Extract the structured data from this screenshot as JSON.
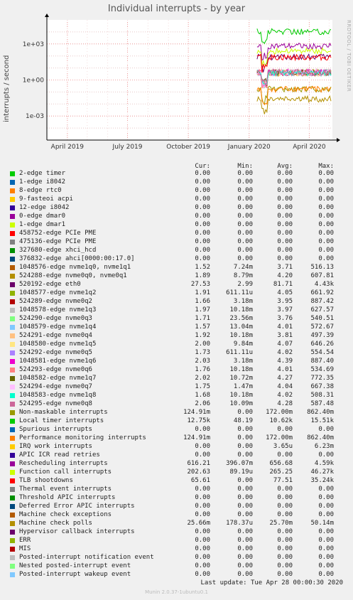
{
  "title": "Individual interrupts - by year",
  "side_label": "RRDTOOL / TOBI OETIKER",
  "footer": {
    "last_update": "Last update: Tue Apr 28 00:00:30 2020",
    "generator": "Munin 2.0.37-1ubuntu0.1"
  },
  "legend_headers": {
    "cur": "Cur:",
    "min": "Min:",
    "avg": "Avg:",
    "max": "Max:"
  },
  "chart_data": {
    "type": "line",
    "title": "Individual interrupts - by year",
    "ylabel": "interrupts / second",
    "yscale": "log",
    "yticks": [
      "1e+03",
      "1e+00",
      "1e-03"
    ],
    "ylim": [
      1e-05,
      100000.0
    ],
    "xticks": [
      "April 2019",
      "July 2019",
      "October 2019",
      "January 2020",
      "April 2020"
    ],
    "grid": true,
    "data_start": "January 2020",
    "series": [
      {
        "name": "2-edge timer",
        "color": "#00cc00",
        "cur": "0.00",
        "min": "0.00",
        "avg": "0.00",
        "max": "0.00"
      },
      {
        "name": "1-edge i8042",
        "color": "#0066b3",
        "cur": "0.00",
        "min": "0.00",
        "avg": "0.00",
        "max": "0.00"
      },
      {
        "name": "8-edge rtc0",
        "color": "#ff8000",
        "cur": "0.00",
        "min": "0.00",
        "avg": "0.00",
        "max": "0.00"
      },
      {
        "name": "9-fasteoi acpi",
        "color": "#ffcc00",
        "cur": "0.00",
        "min": "0.00",
        "avg": "0.00",
        "max": "0.00"
      },
      {
        "name": "12-edge i8042",
        "color": "#330099",
        "cur": "0.00",
        "min": "0.00",
        "avg": "0.00",
        "max": "0.00"
      },
      {
        "name": "0-edge dmar0",
        "color": "#990099",
        "cur": "0.00",
        "min": "0.00",
        "avg": "0.00",
        "max": "0.00"
      },
      {
        "name": "1-edge dmar1",
        "color": "#ccff00",
        "cur": "0.00",
        "min": "0.00",
        "avg": "0.00",
        "max": "0.00"
      },
      {
        "name": "458752-edge PCIe PME",
        "color": "#ff0000",
        "cur": "0.00",
        "min": "0.00",
        "avg": "0.00",
        "max": "0.00"
      },
      {
        "name": "475136-edge PCIe PME",
        "color": "#808080",
        "cur": "0.00",
        "min": "0.00",
        "avg": "0.00",
        "max": "0.00"
      },
      {
        "name": "327680-edge xhci_hcd",
        "color": "#008f00",
        "cur": "0.00",
        "min": "0.00",
        "avg": "0.00",
        "max": "0.00"
      },
      {
        "name": "376832-edge ahci[0000:00:17.0]",
        "color": "#00487d",
        "cur": "0.00",
        "min": "0.00",
        "avg": "0.00",
        "max": "0.00"
      },
      {
        "name": "1048576-edge nvme1q0, nvme1q1",
        "color": "#b35a00",
        "cur": "1.52",
        "min": "7.24m",
        "avg": "3.71",
        "max": "516.13"
      },
      {
        "name": "524288-edge nvme0q0, nvme0q1",
        "color": "#b38f00",
        "cur": "1.89",
        "min": "8.79m",
        "avg": "4.20",
        "max": "607.81"
      },
      {
        "name": "520192-edge eth0",
        "color": "#6b006b",
        "cur": "27.53",
        "min": "2.99",
        "avg": "81.71",
        "max": "4.43k"
      },
      {
        "name": "1048577-edge nvme1q2",
        "color": "#8fb300",
        "cur": "1.91",
        "min": "611.11u",
        "avg": "4.05",
        "max": "661.92"
      },
      {
        "name": "524289-edge nvme0q2",
        "color": "#b30000",
        "cur": "1.66",
        "min": "3.18m",
        "avg": "3.95",
        "max": "887.42"
      },
      {
        "name": "1048578-edge nvme1q3",
        "color": "#bebebe",
        "cur": "1.97",
        "min": "10.18m",
        "avg": "3.97",
        "max": "627.57"
      },
      {
        "name": "524290-edge nvme0q3",
        "color": "#80ff80",
        "cur": "1.71",
        "min": "23.56m",
        "avg": "3.76",
        "max": "540.51"
      },
      {
        "name": "1048579-edge nvme1q4",
        "color": "#80c9ff",
        "cur": "1.57",
        "min": "13.04m",
        "avg": "4.01",
        "max": "572.67"
      },
      {
        "name": "524291-edge nvme0q4",
        "color": "#ffc080",
        "cur": "1.92",
        "min": "10.18m",
        "avg": "3.81",
        "max": "497.39"
      },
      {
        "name": "1048580-edge nvme1q5",
        "color": "#ffe680",
        "cur": "2.00",
        "min": "9.84m",
        "avg": "4.07",
        "max": "646.26"
      },
      {
        "name": "524292-edge nvme0q5",
        "color": "#aa80ff",
        "cur": "1.73",
        "min": "611.11u",
        "avg": "4.02",
        "max": "554.54"
      },
      {
        "name": "1048581-edge nvme1q6",
        "color": "#ee00cc",
        "cur": "2.03",
        "min": "3.18m",
        "avg": "4.39",
        "max": "887.40"
      },
      {
        "name": "524293-edge nvme0q6",
        "color": "#ff8080",
        "cur": "1.76",
        "min": "10.18m",
        "avg": "4.01",
        "max": "534.69"
      },
      {
        "name": "1048582-edge nvme1q7",
        "color": "#666600",
        "cur": "2.02",
        "min": "10.72m",
        "avg": "4.27",
        "max": "772.35"
      },
      {
        "name": "524294-edge nvme0q7",
        "color": "#ffbfff",
        "cur": "1.75",
        "min": "1.47m",
        "avg": "4.04",
        "max": "667.38"
      },
      {
        "name": "1048583-edge nvme1q8",
        "color": "#00ffcc",
        "cur": "1.68",
        "min": "10.18m",
        "avg": "4.02",
        "max": "508.31"
      },
      {
        "name": "524295-edge nvme0q8",
        "color": "#cc6699",
        "cur": "2.06",
        "min": "10.09m",
        "avg": "4.28",
        "max": "587.48"
      },
      {
        "name": "Non-maskable interrupts",
        "color": "#999900",
        "cur": "124.91m",
        "min": "0.00",
        "avg": "172.00m",
        "max": "862.40m"
      },
      {
        "name": "Local timer interrupts",
        "color": "#00cc00",
        "cur": "12.75k",
        "min": "48.19",
        "avg": "10.62k",
        "max": "15.51k"
      },
      {
        "name": "Spurious interrupts",
        "color": "#0066b3",
        "cur": "0.00",
        "min": "0.00",
        "avg": "0.00",
        "max": "0.00"
      },
      {
        "name": "Performance monitoring interrupts",
        "color": "#ff8000",
        "cur": "124.91m",
        "min": "0.00",
        "avg": "172.00m",
        "max": "862.40m"
      },
      {
        "name": "IRQ work interrupts",
        "color": "#ffcc00",
        "cur": "0.00",
        "min": "0.00",
        "avg": "3.65u",
        "max": "6.23m"
      },
      {
        "name": "APIC ICR read retries",
        "color": "#330099",
        "cur": "0.00",
        "min": "0.00",
        "avg": "0.00",
        "max": "0.00"
      },
      {
        "name": "Rescheduling interrupts",
        "color": "#990099",
        "cur": "616.21",
        "min": "396.07m",
        "avg": "656.68",
        "max": "4.59k"
      },
      {
        "name": "Function call interrupts",
        "color": "#ccff00",
        "cur": "202.63",
        "min": "89.19u",
        "avg": "265.25",
        "max": "46.27k"
      },
      {
        "name": "TLB shootdowns",
        "color": "#ff0000",
        "cur": "65.61",
        "min": "0.00",
        "avg": "77.51",
        "max": "35.24k"
      },
      {
        "name": "Thermal event interrupts",
        "color": "#808080",
        "cur": "0.00",
        "min": "0.00",
        "avg": "0.00",
        "max": "0.00"
      },
      {
        "name": "Threshold APIC interrupts",
        "color": "#008f00",
        "cur": "0.00",
        "min": "0.00",
        "avg": "0.00",
        "max": "0.00"
      },
      {
        "name": "Deferred Error APIC interrupts",
        "color": "#00487d",
        "cur": "0.00",
        "min": "0.00",
        "avg": "0.00",
        "max": "0.00"
      },
      {
        "name": "Machine check exceptions",
        "color": "#b35a00",
        "cur": "0.00",
        "min": "0.00",
        "avg": "0.00",
        "max": "0.00"
      },
      {
        "name": "Machine check polls",
        "color": "#b38f00",
        "cur": "25.66m",
        "min": "178.37u",
        "avg": "25.70m",
        "max": "50.14m"
      },
      {
        "name": "Hypervisor callback interrupts",
        "color": "#6b006b",
        "cur": "0.00",
        "min": "0.00",
        "avg": "0.00",
        "max": "0.00"
      },
      {
        "name": "ERR",
        "color": "#8fb300",
        "cur": "0.00",
        "min": "0.00",
        "avg": "0.00",
        "max": "0.00"
      },
      {
        "name": "MIS",
        "color": "#b30000",
        "cur": "0.00",
        "min": "0.00",
        "avg": "0.00",
        "max": "0.00"
      },
      {
        "name": "Posted-interrupt notification event",
        "color": "#bebebe",
        "cur": "0.00",
        "min": "0.00",
        "avg": "0.00",
        "max": "0.00"
      },
      {
        "name": "Nested posted-interrupt event",
        "color": "#80ff80",
        "cur": "0.00",
        "min": "0.00",
        "avg": "0.00",
        "max": "0.00"
      },
      {
        "name": "Posted-interrupt wakeup event",
        "color": "#80c9ff",
        "cur": "0.00",
        "min": "0.00",
        "avg": "0.00",
        "max": "0.00"
      }
    ]
  }
}
